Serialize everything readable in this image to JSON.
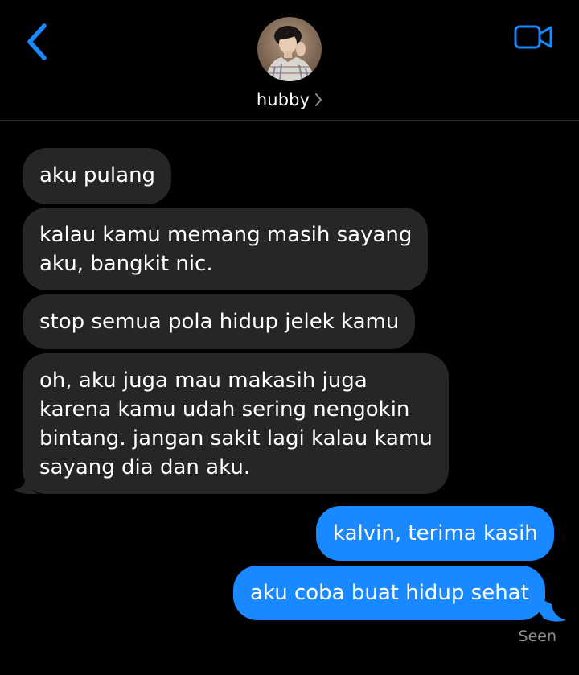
{
  "header": {
    "contact_name": "hubby"
  },
  "icons": {
    "back": "chevron-left-icon",
    "video": "video-camera-icon",
    "name_disclosure": "chevron-right-icon"
  },
  "colors": {
    "accent": "#1a88ff",
    "incoming_bubble": "#262628",
    "background": "#000000",
    "receipt_text": "#8e8e93"
  },
  "messages": [
    {
      "direction": "incoming",
      "lines": [
        "aku pulang"
      ]
    },
    {
      "direction": "incoming",
      "lines": [
        "kalau kamu memang masih sayang",
        "aku, bangkit nic."
      ]
    },
    {
      "direction": "incoming",
      "lines": [
        "stop semua pola hidup jelek kamu"
      ]
    },
    {
      "direction": "incoming",
      "lines": [
        "oh, aku juga mau makasih juga",
        "karena kamu udah sering nengokin",
        "bintang. jangan sakit lagi kalau kamu",
        "sayang dia dan aku."
      ]
    },
    {
      "direction": "outgoing",
      "lines": [
        "kalvin, terima kasih"
      ]
    },
    {
      "direction": "outgoing",
      "lines": [
        "aku coba buat hidup sehat"
      ]
    }
  ],
  "read_receipt": "Seen"
}
